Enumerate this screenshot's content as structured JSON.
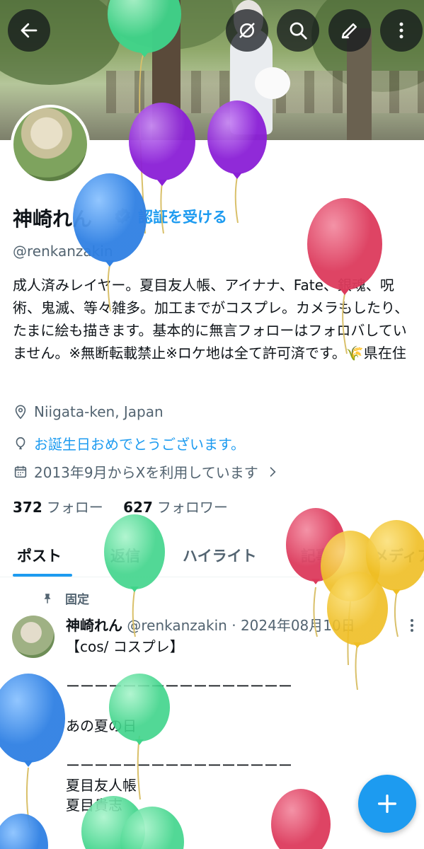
{
  "header": {
    "back_label": "戻る",
    "icons": [
      "back-arrow-icon",
      "grok-icon",
      "search-icon",
      "edit-icon",
      "more-vertical-icon"
    ]
  },
  "profile": {
    "name": "神崎れん",
    "verify_label": "認証を受ける",
    "handle": "@renkanzakin",
    "bio": "成人済みレイヤー。夏目友人帳、アイナナ、Fate、銀魂、呪術、鬼滅、等々雑多。加工までがコスプレ。カメラもしたり、たまに絵も描きます。基本的に無言フォローはフォロバしていません。※無断転載禁止※ロケ地は全て許可済です。🌾県在住",
    "location": "Niigata-ken, Japan",
    "birthday_text": "お誕生日おめでとうございます。",
    "joined": "2013年9月からXを利用しています",
    "following_count": "372",
    "following_label": "フォロー",
    "followers_count": "627",
    "followers_label": "フォロワー"
  },
  "tabs": [
    {
      "label": "ポスト",
      "active": true
    },
    {
      "label": "返信",
      "active": false
    },
    {
      "label": "ハイライト",
      "active": false
    },
    {
      "label": "記事",
      "active": false
    },
    {
      "label": "メディア",
      "active": false
    }
  ],
  "post": {
    "pinned_label": "固定",
    "author": "神崎れん",
    "handle": "@renkanzakin",
    "separator": "·",
    "date": "2024年08月10日",
    "text": "【cos/ コスプレ】\n\nーーーーーーーーーーーーーーーー\n\nあの夏の日\n\nーーーーーーーーーーーーーーーー\n夏目友人帳\n夏目貴志"
  },
  "colors": {
    "accent": "#1d9bf0",
    "balloon_purple": "#9b30e0",
    "balloon_blue": "#3d8ee8",
    "balloon_green": "#5fe0a0",
    "balloon_red": "#e04b6a",
    "balloon_yellow": "#f2c832"
  }
}
